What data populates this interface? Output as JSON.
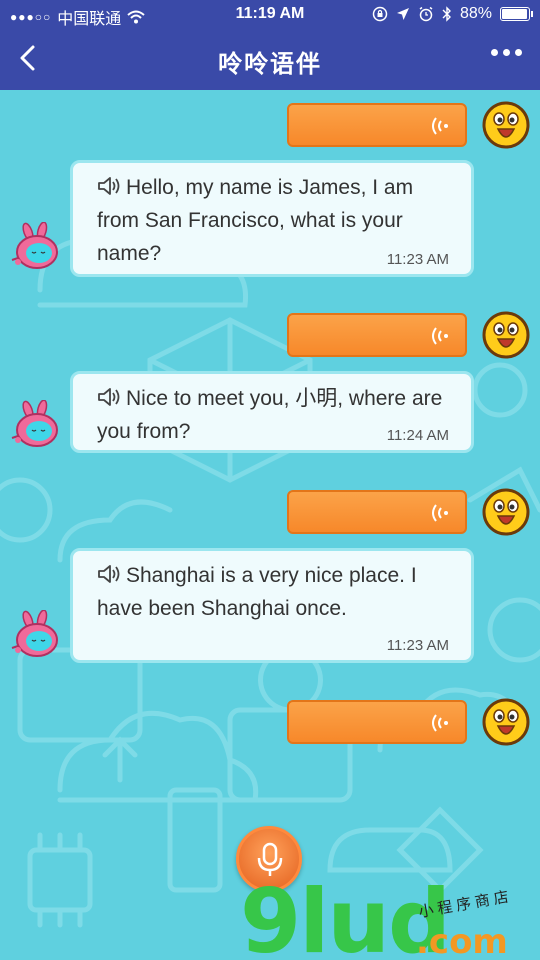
{
  "status_bar": {
    "signal_dots": "●●●○○",
    "carrier": "中国联通",
    "time": "11:19 AM",
    "battery_text": "88%",
    "battery_level": 0.88
  },
  "nav": {
    "title": "呤呤语伴"
  },
  "messages": [
    {
      "type": "user-voice"
    },
    {
      "type": "bot",
      "text": "Hello, my name is James, I am from San Francisco, what is your name?",
      "time": "11:23 AM"
    },
    {
      "type": "user-voice"
    },
    {
      "type": "bot",
      "text": "Nice to meet you, 小明, where are you from?",
      "time": "11:24 AM"
    },
    {
      "type": "user-voice"
    },
    {
      "type": "bot",
      "text": "Shanghai is a very nice place. I have been Shanghai once.",
      "time": "11:23 AM"
    },
    {
      "type": "user-voice"
    }
  ],
  "watermark": {
    "brand": "9lud",
    "domain": ".com",
    "tagline": "小程序商店"
  },
  "colors": {
    "nav_bg": "#3a4aa8",
    "chat_bg": "#5fd0df",
    "voice_bubble": "#f7882a",
    "bot_bubble": "#effbfd",
    "mic_button": "#e3601e"
  }
}
